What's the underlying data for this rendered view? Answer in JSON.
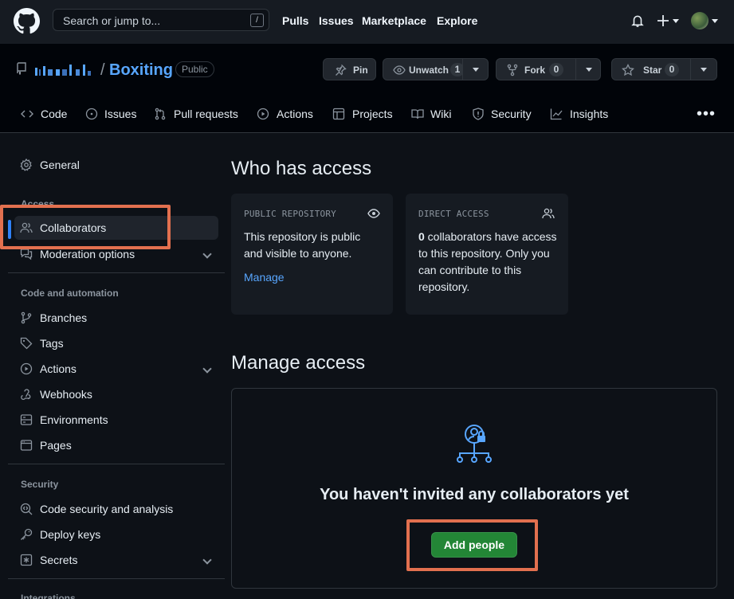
{
  "header": {
    "search_placeholder": "Search or jump to...",
    "search_shortcut": "/",
    "nav": [
      "Pulls",
      "Issues",
      "Marketplace",
      "Explore"
    ]
  },
  "repo": {
    "name": "Boxiting",
    "separator": "/",
    "visibility": "Public",
    "pin_label": "Pin",
    "unwatch_label": "Unwatch",
    "unwatch_count": "1",
    "fork_label": "Fork",
    "fork_count": "0",
    "star_label": "Star",
    "star_count": "0"
  },
  "tabs": [
    "Code",
    "Issues",
    "Pull requests",
    "Actions",
    "Projects",
    "Wiki",
    "Security",
    "Insights"
  ],
  "sidebar": {
    "general": "General",
    "access_group": "Access",
    "collaborators": "Collaborators",
    "moderation": "Moderation options",
    "code_group": "Code and automation",
    "branches": "Branches",
    "tags": "Tags",
    "actions": "Actions",
    "webhooks": "Webhooks",
    "environments": "Environments",
    "pages": "Pages",
    "security_group": "Security",
    "code_security": "Code security and analysis",
    "deploy_keys": "Deploy keys",
    "secrets": "Secrets",
    "integrations_group": "Integrations"
  },
  "main": {
    "who_title": "Who has access",
    "public_card": {
      "label": "PUBLIC REPOSITORY",
      "line1": "This repository is public",
      "line2": "and visible to anyone.",
      "link": "Manage"
    },
    "direct_card": {
      "label": "DIRECT ACCESS",
      "count": "0",
      "line1": " collaborators have access",
      "line2": "to this repository. Only you",
      "line3": "can contribute to this",
      "line4": "repository."
    },
    "manage_title": "Manage access",
    "empty_text": "You haven't invited any collaborators yet",
    "add_button": "Add people"
  },
  "colors": {
    "accent": "#2f81f7",
    "link": "#58a6ff",
    "primary_button": "#238636",
    "highlight": "#e2704f"
  }
}
